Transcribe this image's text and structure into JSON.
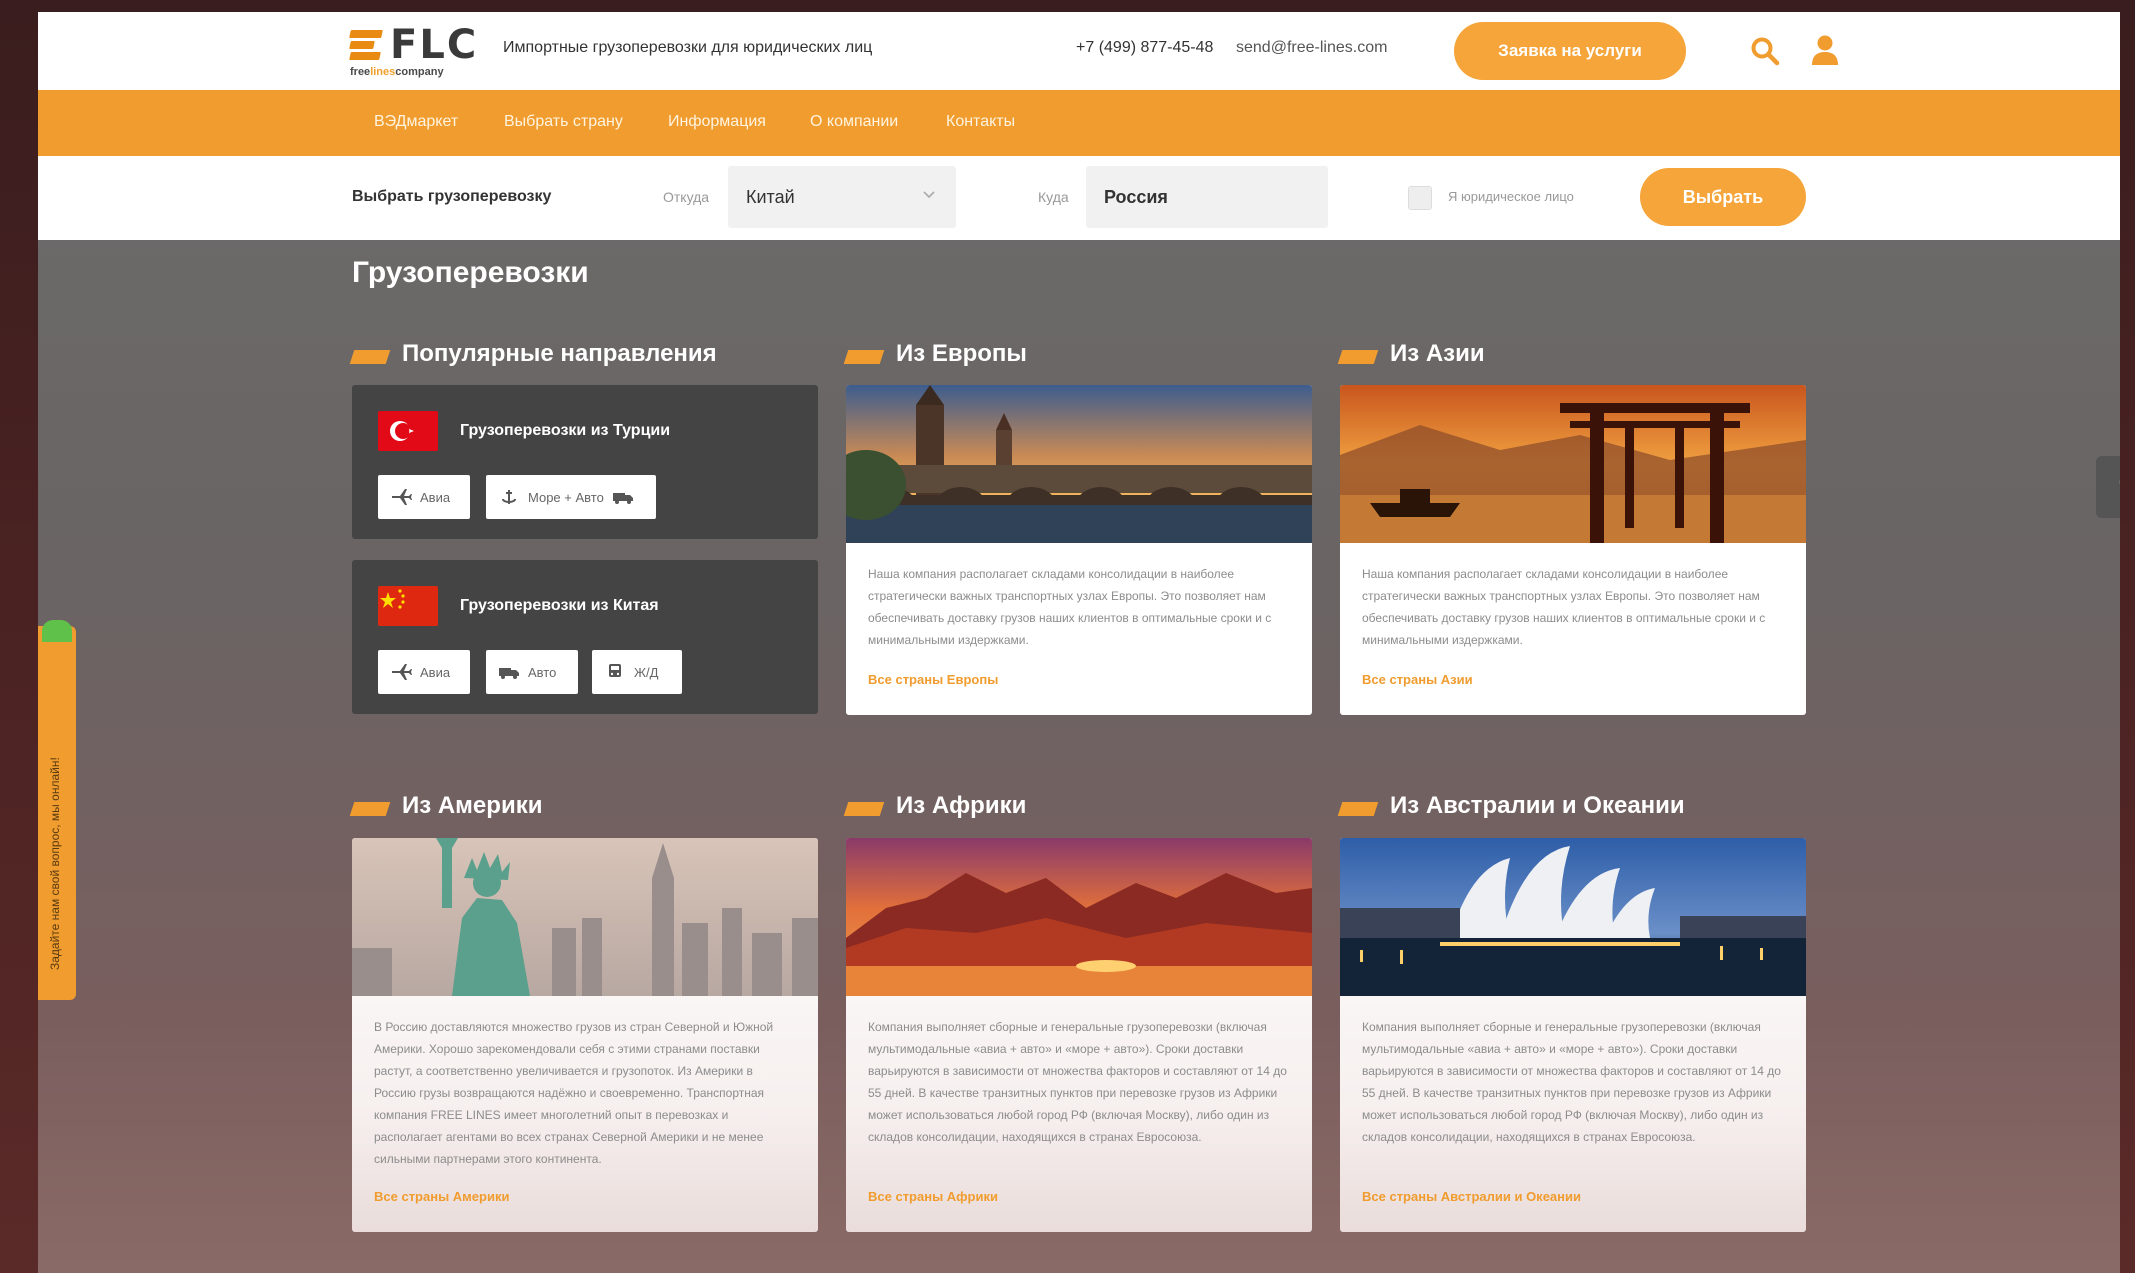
{
  "header": {
    "logo_text": "FLC",
    "logo_sub_1": "free",
    "logo_sub_2": "lines",
    "logo_sub_3": "company",
    "tagline": "Импортные грузоперевозки для юридических лиц",
    "phone": "+7 (499) 877-45-48",
    "email": "send@free-lines.com",
    "order_button": "Заявка на услуги"
  },
  "nav": [
    "ВЭДмаркет",
    "Выбрать страну",
    "Информация",
    "О компании",
    "Контакты"
  ],
  "selector": {
    "title": "Выбрать грузоперевозку",
    "from_label": "Откуда",
    "from_value": "Китай",
    "to_label": "Куда",
    "to_value": "Россия",
    "legal_label": "Я юридическое лицо",
    "choose_button": "Выбрать"
  },
  "page_title": "Грузоперевозки",
  "sections": {
    "popular": "Популярные направления",
    "europe": "Из Европы",
    "asia": "Из Азии",
    "america": "Из Америки",
    "africa": "Из Африки",
    "australia": "Из Австралии и Океании"
  },
  "popular": [
    {
      "title": "Грузоперевозки из Турции",
      "chips": [
        "Авиа",
        "Море + Авто"
      ]
    },
    {
      "title": "Грузоперевозки из Китая",
      "chips": [
        "Авиа",
        "Авто",
        "Ж/Д"
      ]
    }
  ],
  "cards": {
    "europe": {
      "desc": "Наша компания располагает складами консолидации в наиболее стратегически важных транспортных узлах Европы. Это позволяет нам обеспечивать доставку грузов наших клиентов в оптимальные сроки и с минимальными издержками.",
      "more": "Все страны Европы"
    },
    "asia": {
      "desc": "Наша компания располагает складами консолидации в наиболее стратегически важных транспортных узлах Европы. Это позволяет нам обеспечивать доставку грузов наших клиентов в оптимальные сроки и с минимальными издержками.",
      "more": "Все страны Азии"
    },
    "america": {
      "desc": "В Россию доставляются множество грузов из стран Северной и Южной Америки. Хорошо зарекомендовали себя с этими странами поставки растут, а соответственно увеличивается и грузопоток. Из Америки в Россию грузы возвращаются надёжно и своевременно. Транспортная компания FREE LINES имеет многолетний опыт в перевозках и располагает агентами во всех странах Северной Америки и не менее сильными партнерами этого континента.",
      "more": "Все страны Америки"
    },
    "africa": {
      "desc": "Компания выполняет сборные и генеральные грузоперевозки (включая мультимодальные «авиа + авто» и «море + авто»). Сроки доставки варьируются в зависимости от множества факторов и составляют от 14 до 55 дней. В качестве транзитных пунктов при перевозке грузов из Африки может использоваться любой город РФ (включая Москву), либо один из складов консолидации, находящихся в странах Евросоюза.",
      "more": "Все страны Африки"
    },
    "australia": {
      "desc": "Компания выполняет сборные и генеральные грузоперевозки (включая мультимодальные «авиа + авто» и «море + авто»). Сроки доставки варьируются в зависимости от множества факторов и составляют от 14 до 55 дней. В качестве транзитных пунктов при перевозке грузов из Африки может использоваться любой город РФ (включая Москву), либо один из складов консолидации, находящихся в странах Евросоюза.",
      "more": "Все страны Австралии и Океании"
    }
  },
  "callback_text": "Задайте нам свой вопрос, мы онлайн!",
  "colors": {
    "accent": "#f09c2e",
    "button": "#f5a53a",
    "dark_card": "#444444"
  }
}
